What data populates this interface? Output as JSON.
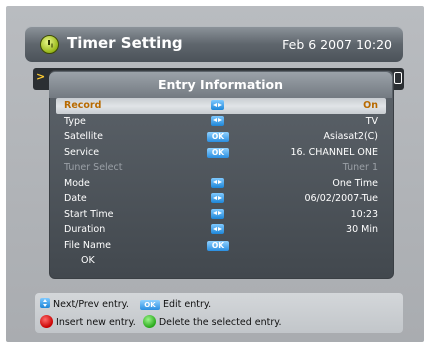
{
  "header": {
    "title": "Timer Setting",
    "datetime": "Feb 6 2007 10:20"
  },
  "popup": {
    "title": "Entry Information",
    "rows": [
      {
        "label": "Record",
        "value": "On",
        "control": "arrows",
        "selected": true
      },
      {
        "label": "Type",
        "value": "TV",
        "control": "arrows"
      },
      {
        "label": "Satellite",
        "value": "Asiasat2(C)",
        "control": "ok"
      },
      {
        "label": "Service",
        "value": "16. CHANNEL ONE",
        "control": "ok"
      },
      {
        "label": "Tuner Select",
        "value": "Tuner 1",
        "control": "none",
        "disabled": true
      },
      {
        "label": "Mode",
        "value": "One Time",
        "control": "arrows"
      },
      {
        "label": "Date",
        "value": "06/02/2007-Tue",
        "control": "arrows"
      },
      {
        "label": "Start Time",
        "value": "10:23",
        "control": "arrows"
      },
      {
        "label": "Duration",
        "value": "30 Min",
        "control": "arrows"
      },
      {
        "label": "File Name",
        "value": "",
        "control": "ok"
      }
    ],
    "ok_label": "OK",
    "ok_key": "OK"
  },
  "help": {
    "next_prev": "Next/Prev entry.",
    "ok_key": "OK",
    "edit": "Edit entry.",
    "insert": "Insert new entry.",
    "delete": "Delete the selected entry."
  },
  "colors": {
    "selected_text": "#b86a00",
    "key_blue": "#1e86d8",
    "key_red": "#c80000",
    "key_green": "#28a81a"
  }
}
